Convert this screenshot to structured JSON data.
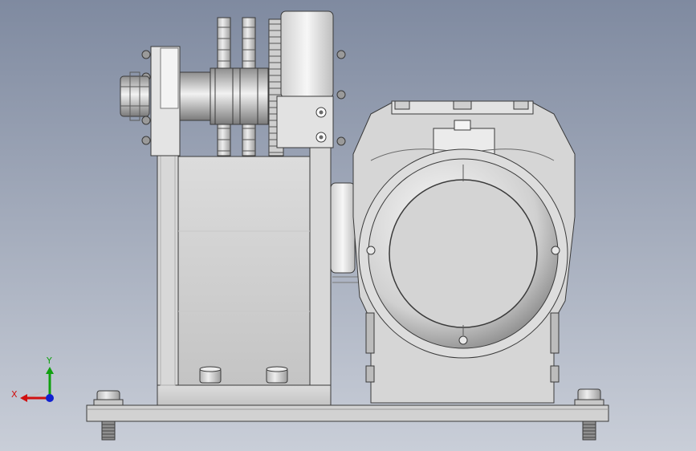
{
  "viewport": {
    "background_top": "#7f8aa0",
    "background_bottom": "#c9ced8"
  },
  "model": {
    "body_color": "#d9d9d9",
    "shade_color": "#a8a8a8",
    "edge_color": "#3a3a3a"
  },
  "triad": {
    "x_label": "X",
    "y_label": "Y",
    "x_color": "#d01010",
    "y_color": "#10a010",
    "z_color": "#1020d0"
  }
}
